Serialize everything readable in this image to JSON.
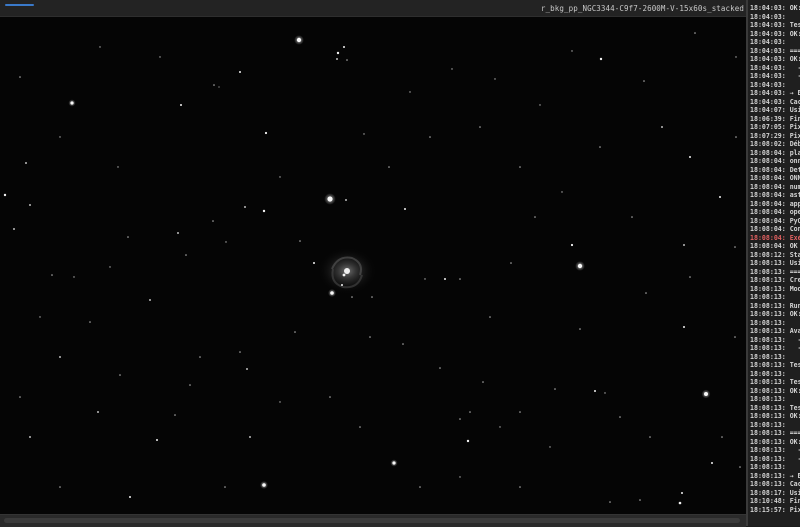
{
  "window": {
    "filename": "r_bkg_pp_NGC3344-C9f7-2600M-V-15x60s_stacked",
    "progress": 0.05
  },
  "viewer": {
    "subject": "NGC3344 galaxy star field",
    "background_color": "#050505",
    "star_color": "#ffffff"
  },
  "log": {
    "lines": [
      {
        "text": "18:04:03: OK:",
        "error": false
      },
      {
        "text": "18:04:03:",
        "error": false
      },
      {
        "text": "18:04:03: Test",
        "error": false
      },
      {
        "text": "18:04:03: OK:",
        "error": false
      },
      {
        "text": "18:04:03:",
        "error": false
      },
      {
        "text": "18:04:03: ===",
        "error": false
      },
      {
        "text": "18:04:03: OK:",
        "error": false
      },
      {
        "text": "18:04:03:   -",
        "error": false
      },
      {
        "text": "18:04:03:   -",
        "error": false
      },
      {
        "text": "18:04:03:",
        "error": false
      },
      {
        "text": "18:04:03: → Be",
        "error": false
      },
      {
        "text": "18:04:03: Cach",
        "error": false
      },
      {
        "text": "18:04:07: Usin",
        "error": false
      },
      {
        "text": "18:06:39: Fini",
        "error": false
      },
      {
        "text": "18:07:05: Pixe",
        "error": false
      },
      {
        "text": "18:07:29: Pixe",
        "error": false
      },
      {
        "text": "18:08:02: Débu",
        "error": false
      },
      {
        "text": "18:08:04: plat",
        "error": false
      },
      {
        "text": "18:08:04: onnx",
        "error": false
      },
      {
        "text": "18:08:04: Dete",
        "error": false
      },
      {
        "text": "18:08:04: ONNX",
        "error": false
      },
      {
        "text": "18:08:04: nump",
        "error": false
      },
      {
        "text": "18:08:04: astr",
        "error": false
      },
      {
        "text": "18:08:04: appd",
        "error": false
      },
      {
        "text": "18:08:04: open",
        "error": false
      },
      {
        "text": "18:08:04: PyQt",
        "error": false
      },
      {
        "text": "18:08:04: Conn",
        "error": false
      },
      {
        "text": "18:08:04: Exéc",
        "error": true
      },
      {
        "text": "18:08:04: OK !",
        "error": false
      },
      {
        "text": "18:08:12: Star",
        "error": false
      },
      {
        "text": "18:08:13: Usin",
        "error": false
      },
      {
        "text": "18:08:13: ===",
        "error": false
      },
      {
        "text": "18:08:13: Crea",
        "error": false
      },
      {
        "text": "18:08:13: Mode",
        "error": false
      },
      {
        "text": "18:08:13:",
        "error": false
      },
      {
        "text": "18:08:13: Runn",
        "error": false
      },
      {
        "text": "18:08:13: OK:",
        "error": false
      },
      {
        "text": "18:08:13:",
        "error": false
      },
      {
        "text": "18:08:13: Avai",
        "error": false
      },
      {
        "text": "18:08:13:   -",
        "error": false
      },
      {
        "text": "18:08:13:   -",
        "error": false
      },
      {
        "text": "18:08:13:",
        "error": false
      },
      {
        "text": "18:08:13: Test",
        "error": false
      },
      {
        "text": "18:08:13:",
        "error": false
      },
      {
        "text": "18:08:13: Test",
        "error": false
      },
      {
        "text": "18:08:13: OK:",
        "error": false
      },
      {
        "text": "18:08:13:",
        "error": false
      },
      {
        "text": "18:08:13: Test",
        "error": false
      },
      {
        "text": "18:08:13: OK:",
        "error": false
      },
      {
        "text": "18:08:13:",
        "error": false
      },
      {
        "text": "18:08:13: ===",
        "error": false
      },
      {
        "text": "18:08:13: OK:",
        "error": false
      },
      {
        "text": "18:08:13:   -",
        "error": false
      },
      {
        "text": "18:08:13:   -",
        "error": false
      },
      {
        "text": "18:08:13:",
        "error": false
      },
      {
        "text": "18:08:13: → Be",
        "error": false
      },
      {
        "text": "18:08:13: Cach",
        "error": false
      },
      {
        "text": "18:08:17: Usin",
        "error": false
      },
      {
        "text": "18:10:48: Fini",
        "error": false
      },
      {
        "text": "18:15:57: Pixe",
        "error": false
      }
    ]
  }
}
